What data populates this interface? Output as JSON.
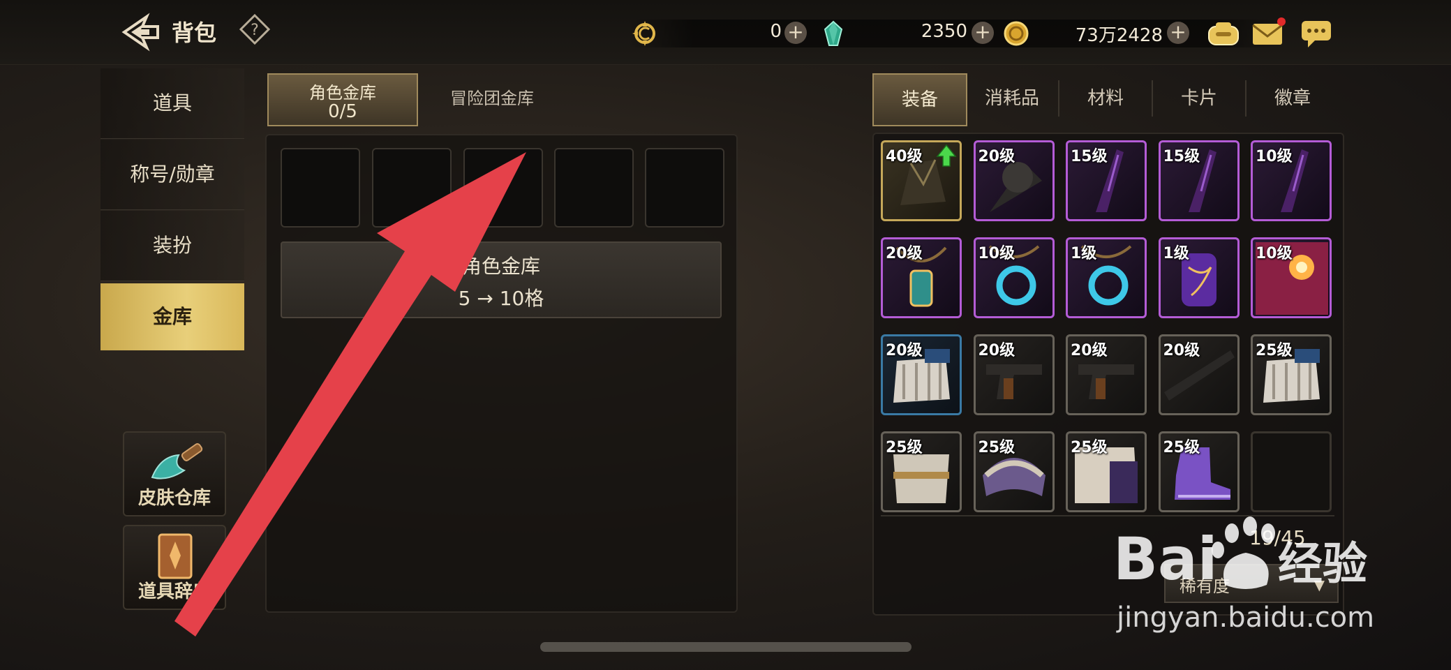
{
  "header": {
    "title": "背包",
    "currencies": [
      {
        "icon": "rune-coin-icon",
        "value": "0"
      },
      {
        "icon": "crystal-icon",
        "value": "2350"
      },
      {
        "icon": "gold-coin-icon",
        "value": "73万2428"
      }
    ]
  },
  "left_nav": {
    "items": [
      {
        "label": "道具",
        "active": false
      },
      {
        "label": "称号/勋章",
        "active": false
      },
      {
        "label": "装扮",
        "active": false
      },
      {
        "label": "金库",
        "active": true
      }
    ],
    "side_buttons": [
      {
        "label": "皮肤仓库",
        "icon": "brush-icon"
      },
      {
        "label": "道具辞典",
        "icon": "book-icon"
      }
    ]
  },
  "vault": {
    "tabs": [
      {
        "label": "角色金库",
        "count": "0/5",
        "active": true
      },
      {
        "label": "冒险团金库",
        "active": false
      }
    ],
    "slots": 5,
    "unlock_title": "角色金库",
    "unlock_sub": "5 → 10格"
  },
  "inventory": {
    "tabs": [
      {
        "label": "装备",
        "active": true
      },
      {
        "label": "消耗品",
        "active": false
      },
      {
        "label": "材料",
        "active": false
      },
      {
        "label": "卡片",
        "active": false
      },
      {
        "label": "徽章",
        "active": false
      }
    ],
    "items": [
      {
        "level": "40级",
        "quality": "gold",
        "icon": "dark-armor-icon",
        "upgrade": true
      },
      {
        "level": "20级",
        "quality": "purple",
        "icon": "axe-icon"
      },
      {
        "level": "15级",
        "quality": "purple",
        "icon": "blade-icon"
      },
      {
        "level": "15级",
        "quality": "purple",
        "icon": "blade-icon"
      },
      {
        "level": "10级",
        "quality": "purple",
        "icon": "blade-icon"
      },
      {
        "level": "20级",
        "quality": "purple",
        "icon": "amulet-icon"
      },
      {
        "level": "10级",
        "quality": "purple",
        "icon": "ring-necklace-icon"
      },
      {
        "level": "1级",
        "quality": "purple",
        "icon": "ring-necklace-icon"
      },
      {
        "level": "1级",
        "quality": "purple",
        "icon": "bracer-icon"
      },
      {
        "level": "10级",
        "quality": "purple",
        "icon": "orb-icon"
      },
      {
        "level": "20级",
        "quality": "blue",
        "icon": "gauntlet-icon"
      },
      {
        "level": "20级",
        "quality": "grey",
        "icon": "pistol-icon"
      },
      {
        "level": "20级",
        "quality": "grey",
        "icon": "pistol-icon"
      },
      {
        "level": "20级",
        "quality": "grey",
        "icon": "rifle-icon"
      },
      {
        "level": "25级",
        "quality": "grey",
        "icon": "gauntlet-icon"
      },
      {
        "level": "25级",
        "quality": "grey",
        "icon": "chest-armor-icon"
      },
      {
        "level": "25级",
        "quality": "grey",
        "icon": "shoulder-armor-icon"
      },
      {
        "level": "25级",
        "quality": "grey",
        "icon": "leg-armor-icon"
      },
      {
        "level": "25级",
        "quality": "grey",
        "icon": "boots-icon"
      },
      {
        "level": "",
        "quality": "empty",
        "icon": ""
      }
    ],
    "count": "19/45",
    "sort_label": "稀有度",
    "sort_arrow": "▼"
  },
  "watermark": {
    "brand": "Bai 经验",
    "url": "jingyan.baidu.com"
  },
  "colors": {
    "accent_gold": "#d9b85a",
    "arrow": "#e5414a",
    "purple": "#b45cd6",
    "blue": "#3a7aa5"
  }
}
